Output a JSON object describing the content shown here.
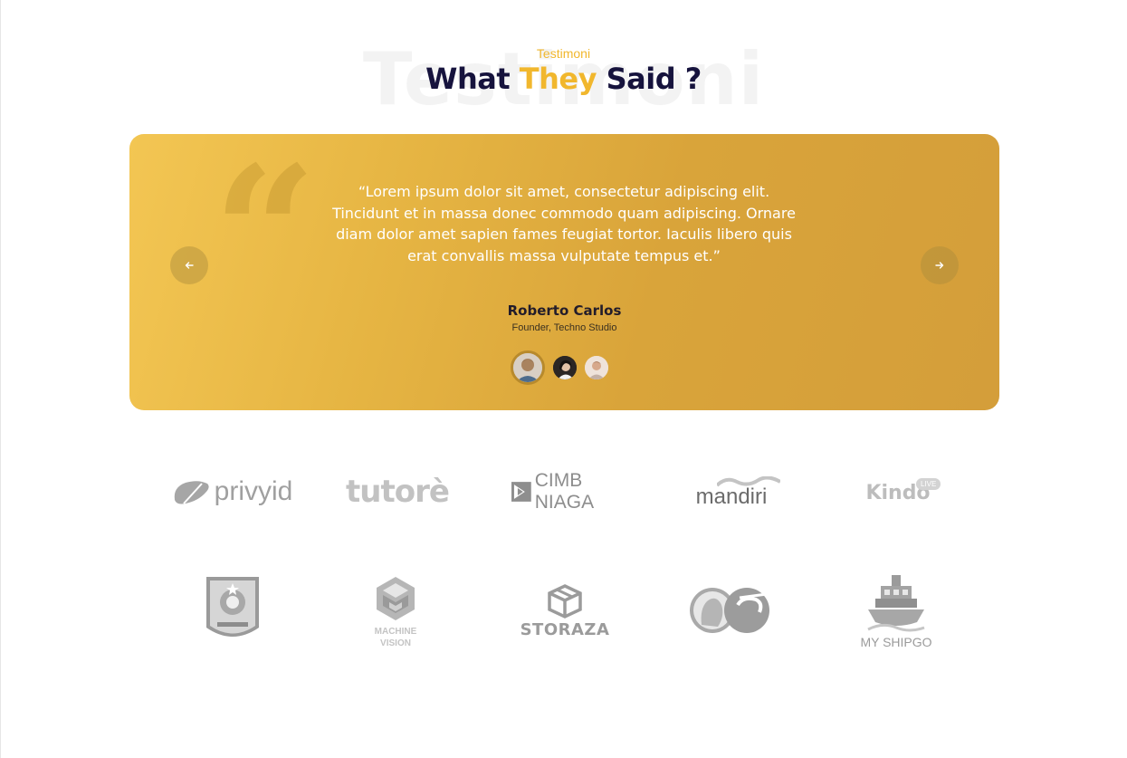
{
  "section": {
    "background_word": "Testimoni",
    "eyebrow": "Testimoni",
    "title_before": "What ",
    "title_accent": "They",
    "title_after": " Said ?"
  },
  "testimonial": {
    "quote": "“Lorem ipsum dolor sit amet, consectetur adipiscing elit. Tincidunt et in massa donec commodo quam adipiscing. Ornare diam dolor amet sapien fames feugiat tortor. Iaculis libero quis erat convallis massa vulputate tempus et.”",
    "name": "Roberto Carlos",
    "role": "Founder, Techno Studio",
    "prev_icon": "arrow-left-icon",
    "next_icon": "arrow-right-icon",
    "active_index": 0
  },
  "clients": {
    "row1": [
      {
        "name": "privyid",
        "text": "privyid"
      },
      {
        "name": "tutore",
        "text": "tutorè"
      },
      {
        "name": "cimb-niaga",
        "text": "CIMB NIAGA"
      },
      {
        "name": "mandiri",
        "text": "mandiri"
      },
      {
        "name": "kindo",
        "text": "Kindo",
        "badge": "LIVE"
      }
    ],
    "row2": [
      {
        "name": "government-emblem"
      },
      {
        "name": "machine-vision",
        "text": "MACHINE VISION"
      },
      {
        "name": "storaza",
        "text": "STORAZA"
      },
      {
        "name": "ot-logo",
        "text": "OT"
      },
      {
        "name": "my-shipgo",
        "text": "MY SHIPGO"
      }
    ]
  },
  "colors": {
    "accent": "#f1b72d",
    "heading": "#16133d",
    "card_start": "#f3c653",
    "card_end": "#d49e3a",
    "logo_gray": "#9d9d9d"
  }
}
